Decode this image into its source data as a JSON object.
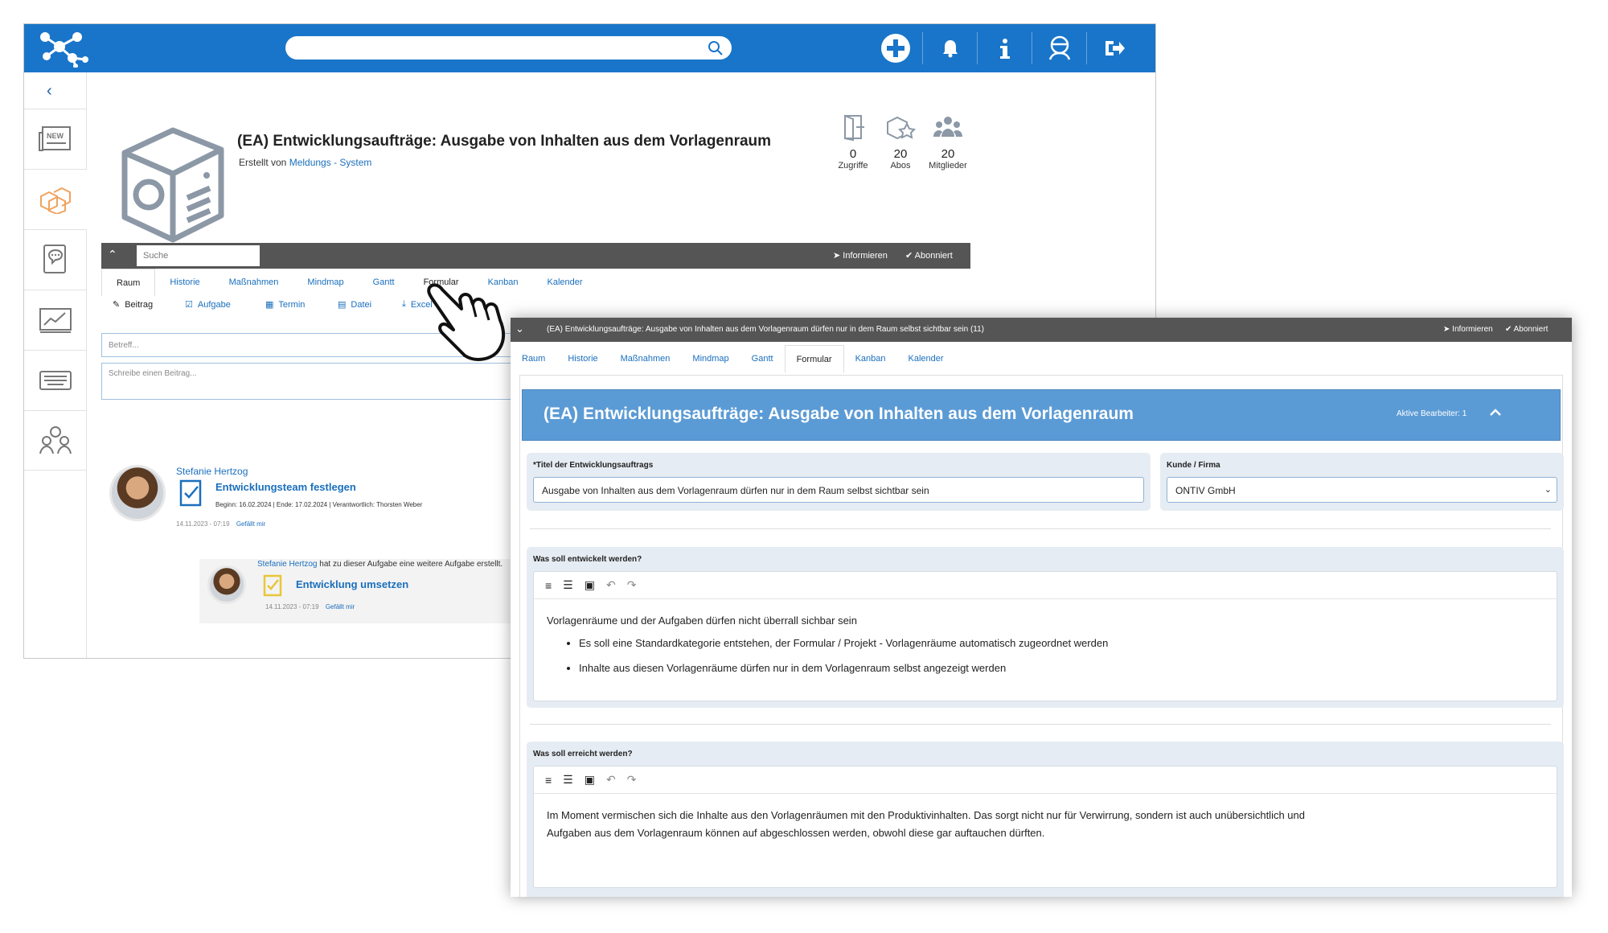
{
  "back": {
    "room": {
      "title": "(EA) Entwicklungsaufträge:  Ausgabe von Inhalten aus dem Vorlagenraum",
      "created_by": "Erstellt von",
      "creator": "Meldungs - System"
    },
    "stats": [
      {
        "value": "0",
        "label": "Zugriffe"
      },
      {
        "value": "20",
        "label": "Abos"
      },
      {
        "value": "20",
        "label": "Mitglieder"
      }
    ],
    "toolbar": {
      "search_placeholder": "Suche",
      "inform": "Informieren",
      "subscribed": "Abonniert"
    },
    "tabs": [
      "Raum",
      "Historie",
      "Maßnahmen",
      "Mindmap",
      "Gantt",
      "Formular",
      "Kanban",
      "Kalender"
    ],
    "post_actions": [
      "Beitrag",
      "Aufgabe",
      "Termin",
      "Datei",
      "Excel"
    ],
    "subject_placeholder": "Betreff...",
    "body_placeholder": "Schreibe einen Beitrag...",
    "feed": {
      "author": "Stefanie Hertzog",
      "task": "Entwicklungsteam festlegen",
      "meta": "Beginn: 16.02.2024 | Ende: 17.02.2024 | Verantwortlich: Thorsten Weber",
      "time": "14.11.2023 - 07:19",
      "like": "Gefällt mir",
      "reply_author": "Stefanie Hertzog",
      "reply_text": "hat zu dieser Aufgabe eine weitere Aufgabe erstellt.",
      "reply_task": "Entwicklung umsetzen",
      "reply_time": "14.11.2023 - 07:19",
      "reply_like": "Gefällt mir"
    }
  },
  "front": {
    "bar_title": "(EA) Entwicklungsaufträge: Ausgabe von Inhalten aus dem Vorlagenraum dürfen nur in dem Raum selbst sichtbar sein (11)",
    "inform": "Informieren",
    "subscribed": "Abonniert",
    "tabs": [
      "Raum",
      "Historie",
      "Maßnahmen",
      "Mindmap",
      "Gantt",
      "Formular",
      "Kanban",
      "Kalender"
    ],
    "active_tab": "Formular",
    "form_title": "(EA) Entwicklungsaufträge: Ausgabe von Inhalten aus dem Vorlagenraum",
    "active_editors": "Aktive Bearbeiter: 1",
    "title_label": "*Titel der Entwicklungsauftrags",
    "title_value": "Ausgabe von Inhalten aus dem Vorlagenraum dürfen nur in dem Raum selbst sichtbar sein",
    "customer_label": "Kunde / Firma",
    "customer_value": "ONTIV GmbH",
    "section1": {
      "label": "Was soll entwickelt werden?",
      "intro": "Vorlagenräume und der Aufgaben dürfen nicht überrall sichbar sein",
      "bullets": [
        "Es soll eine Standardkategorie entstehen, der Formular / Projekt - Vorlagenräume automatisch zugeordnet werden",
        "Inhalte aus diesen Vorlagenräume dürfen nur in dem Vorlagenraum selbst angezeigt werden"
      ]
    },
    "section2": {
      "label": "Was soll erreicht werden?",
      "line1": "Im Moment vermischen sich die Inhalte aus den Vorlagenräumen mit den Produktivinhalten. Das sorgt nicht nur für Verwirrung, sondern ist auch unübersichtlich und",
      "line2": "Aufgaben aus dem Vorlagenraum können auf abgeschlossen werden, obwohl diese gar auftauchen dürften."
    }
  },
  "icons": [
    "network-logo-icon",
    "search-icon",
    "plus-circle-icon",
    "bell-icon",
    "info-icon",
    "user-icon",
    "logout-icon",
    "chevron-left-icon",
    "news-icon",
    "boxes-icon",
    "chat-icon",
    "chart-icon",
    "keyboard-icon",
    "group-icon",
    "pointer-hand-icon"
  ],
  "colors": {
    "brand": "#1975c9",
    "form_header": "#5b9bd5",
    "dark_bar": "#555555",
    "link": "#1a6fbd",
    "active_sidebar": "#f0a35e"
  }
}
